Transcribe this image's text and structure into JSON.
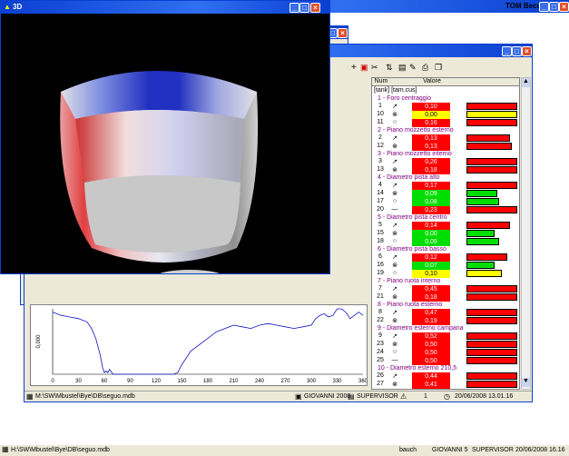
{
  "window3d": {
    "title": "3D"
  },
  "app": {
    "title_right": "TOM Becu"
  },
  "table": {
    "col_num": "Num",
    "col_value": "Valore",
    "units": "[tank] [tam.cus]",
    "sections": [
      {
        "title": "1 - Foro centraggio",
        "rows": [
          {
            "num": "1",
            "value": "0,10",
            "color": "#ff0000",
            "bar": 1.0
          },
          {
            "num": "10",
            "value": "0,00",
            "color": "#ffff00",
            "bar": 1.0
          },
          {
            "num": "11",
            "value": "0,16",
            "color": "#ff0000",
            "bar": 1.0
          }
        ]
      },
      {
        "title": "2 - Piano mozzetto esterno",
        "rows": [
          {
            "num": "2",
            "value": "0,13",
            "color": "#ff0000",
            "bar": 0.85
          },
          {
            "num": "12",
            "value": "0,13",
            "color": "#ff0000",
            "bar": 0.9
          }
        ]
      },
      {
        "title": "3 - Piano mozzetto interno",
        "rows": [
          {
            "num": "3",
            "value": "0,26",
            "color": "#ff0000",
            "bar": 1.0
          },
          {
            "num": "13",
            "value": "0,18",
            "color": "#ff0000",
            "bar": 1.0
          }
        ]
      },
      {
        "title": "4 - Diametro pista alto",
        "rows": [
          {
            "num": "4",
            "value": "0,17",
            "color": "#ff0000",
            "bar": 1.0
          },
          {
            "num": "14",
            "value": "0,09",
            "color": "#00dd00",
            "bar": 0.6
          },
          {
            "num": "17",
            "value": "0,08",
            "color": "#00dd00",
            "bar": 0.65
          },
          {
            "num": "20",
            "value": "0,23",
            "color": "#ff0000",
            "bar": 1.0
          }
        ]
      },
      {
        "title": "5 - Diametro pista centro",
        "rows": [
          {
            "num": "5",
            "value": "0,14",
            "color": "#ff0000",
            "bar": 0.85
          },
          {
            "num": "15",
            "value": "0,00",
            "color": "#00dd00",
            "bar": 0.55
          },
          {
            "num": "18",
            "value": "0,09",
            "color": "#00dd00",
            "bar": 0.65
          }
        ]
      },
      {
        "title": "6 - Diametro pista basso",
        "rows": [
          {
            "num": "6",
            "value": "0,12",
            "color": "#ff0000",
            "bar": 0.8
          },
          {
            "num": "16",
            "value": "0,07",
            "color": "#00dd00",
            "bar": 0.55
          },
          {
            "num": "19",
            "value": "0,10",
            "color": "#ffff00",
            "bar": 0.7
          }
        ]
      },
      {
        "title": "7 - Piano ruota interno",
        "rows": [
          {
            "num": "7",
            "value": "0,45",
            "color": "#ff0000",
            "bar": 1.0
          },
          {
            "num": "21",
            "value": "0,18",
            "color": "#ff0000",
            "bar": 1.0
          }
        ]
      },
      {
        "title": "8 - Piano ruota esterno",
        "rows": [
          {
            "num": "8",
            "value": "0,47",
            "color": "#ff0000",
            "bar": 1.0
          },
          {
            "num": "22",
            "value": "0,19",
            "color": "#ff0000",
            "bar": 1.0
          }
        ]
      },
      {
        "title": "9 - Diametro esterno campana",
        "rows": [
          {
            "num": "9",
            "value": "0,52",
            "color": "#ff0000",
            "bar": 1.0
          },
          {
            "num": "23",
            "value": "0,50",
            "color": "#ff0000",
            "bar": 1.0
          },
          {
            "num": "24",
            "value": "0,50",
            "color": "#ff0000",
            "bar": 1.0
          },
          {
            "num": "25",
            "value": "0,50",
            "color": "#ff0000",
            "bar": 1.0
          }
        ]
      },
      {
        "title": "10 - Diametro esterno 210,5",
        "rows": [
          {
            "num": "26",
            "value": "0,44",
            "color": "#ff0000",
            "bar": 1.0
          },
          {
            "num": "27",
            "value": "0,41",
            "color": "#ff0000",
            "bar": 1.0
          }
        ]
      }
    ]
  },
  "chart_data": {
    "type": "line",
    "x_ticks": [
      "0",
      "30",
      "60",
      "90",
      "120",
      "150",
      "180",
      "210",
      "240",
      "270",
      "300",
      "330",
      "360"
    ],
    "y_tick": "0,000",
    "xlim": [
      0,
      360
    ],
    "ylim": [
      -1,
      1
    ],
    "x": [
      0,
      10,
      20,
      30,
      40,
      45,
      50,
      55,
      58,
      60,
      62,
      64,
      66,
      70,
      80,
      100,
      120,
      140,
      145,
      150,
      155,
      160,
      170,
      180,
      190,
      200,
      210,
      220,
      230,
      240,
      250,
      260,
      270,
      280,
      290,
      300,
      305,
      310,
      315,
      320,
      325,
      330,
      335,
      340,
      345,
      350,
      355,
      360
    ],
    "y": [
      0.9,
      0.8,
      0.75,
      0.7,
      0.6,
      0.4,
      0.1,
      -0.4,
      -0.8,
      -0.95,
      -0.9,
      -0.95,
      -0.85,
      -1,
      -1,
      -1,
      -1,
      -1,
      -0.95,
      -0.7,
      -0.5,
      -0.3,
      -0.1,
      0.1,
      0.3,
      0.4,
      0.5,
      0.45,
      0.4,
      0.5,
      0.55,
      0.5,
      0.45,
      0.4,
      0.45,
      0.5,
      0.7,
      0.8,
      0.85,
      0.75,
      0.8,
      1.0,
      1.1,
      0.9,
      0.7,
      0.8,
      0.9,
      0.8
    ]
  },
  "main_status": {
    "path": "M:\\SW\\Mbustel\\Bye\\DB\\seguo.mdb",
    "user": "GIOVANNI 2008",
    "role": "SUPERVISOR",
    "count": "1",
    "datetime": "20/06/2008 13.01.16"
  },
  "taskbar": {
    "path": "H:\\SW\\Mbustel\\Bye\\DB\\seguo.mdb",
    "user": "bauch",
    "name": "GIOVANNI 5",
    "role": "SUPERVISOR",
    "date": "20/06/2008",
    "time": "16.16"
  }
}
